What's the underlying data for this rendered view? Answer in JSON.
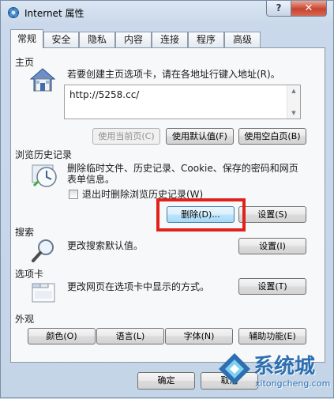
{
  "window": {
    "title": "Internet 属性",
    "help_label": "?",
    "close_label": "✕"
  },
  "tabs": [
    {
      "label": "常规"
    },
    {
      "label": "安全"
    },
    {
      "label": "隐私"
    },
    {
      "label": "内容"
    },
    {
      "label": "连接"
    },
    {
      "label": "程序"
    },
    {
      "label": "高级"
    }
  ],
  "home": {
    "group_label": "主页",
    "description": "若要创建主页选项卡，请在各地址行键入地址(R)。",
    "url": "http://5258.cc/",
    "use_current_label": "使用当前页(C)",
    "use_default_label": "使用默认值(F)",
    "use_blank_label": "使用空白页(B)",
    "icon": "house-icon"
  },
  "history": {
    "group_label": "浏览历史记录",
    "description_line1": "删除临时文件、历史记录、Cookie、保存的密码和网页",
    "description_line2": "表单信息。",
    "checkbox_label": "退出时删除浏览历史记录(W)",
    "checkbox_checked": false,
    "delete_label": "删除(D)...",
    "settings_label": "设置(S)",
    "icon": "history-clock-icon"
  },
  "search": {
    "group_label": "搜索",
    "description": "更改搜索默认值。",
    "settings_label": "设置(I)",
    "icon": "magnifier-icon"
  },
  "tabs_section": {
    "group_label": "选项卡",
    "description": "更改网页在选项卡中显示的方式。",
    "settings_label": "设置(T)",
    "icon": "tabs-window-icon"
  },
  "appearance": {
    "group_label": "外观",
    "colors_label": "颜色(O)",
    "languages_label": "语言(L)",
    "fonts_label": "字体(N)",
    "accessibility_label": "辅助功能(E)"
  },
  "dialog": {
    "ok_label": "确定",
    "cancel_label": "取消"
  },
  "watermark": {
    "text": "系统城",
    "sub": "xitongcheng.com"
  },
  "colors": {
    "highlight": "#e0221c",
    "watermark": "#2d6fb0"
  }
}
